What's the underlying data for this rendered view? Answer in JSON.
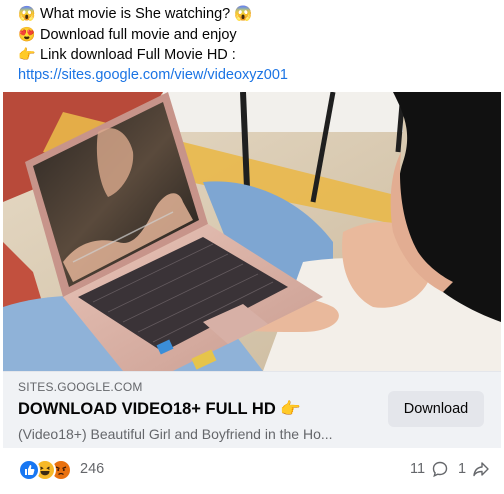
{
  "post": {
    "lines": [
      {
        "emoji": "😱",
        "text": "What movie is She watching? 😱"
      },
      {
        "emoji": "😍",
        "text": "Download full movie and enjoy"
      },
      {
        "emoji": "👉",
        "text": "Link download Full Movie HD :"
      }
    ],
    "link": "https://sites.google.com/view/videoxyz001"
  },
  "preview": {
    "domain": "SITES.GOOGLE.COM",
    "title": "DOWNLOAD VIDEO18+ FULL HD 👉",
    "description": "(Video18+) Beautiful Girl and Boyfriend in the Ho...",
    "button_label": "Download"
  },
  "footer": {
    "reaction_count": "246",
    "comment_count": "11",
    "share_count": "1"
  },
  "colors": {
    "link": "#1b74e4",
    "like": "#1877f2",
    "haha": "#f7b928",
    "angry": "#e9710f"
  }
}
